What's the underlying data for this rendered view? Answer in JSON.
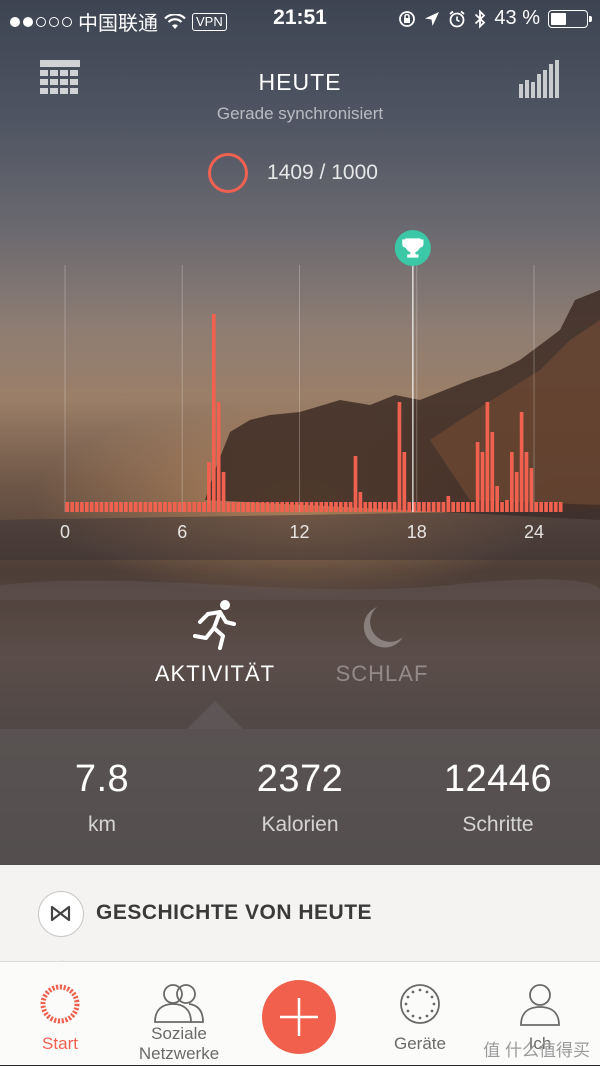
{
  "status_bar": {
    "carrier": "中国联通",
    "vpn": "VPN",
    "time": "21:51",
    "battery": "43 %",
    "battery_level": 0.43,
    "signal_dots_filled": 2,
    "signal_dots_total": 5
  },
  "header": {
    "title": "HEUTE",
    "subtitle": "Gerade synchronisiert",
    "goal_text": "1409 / 1000",
    "calendar_icon": "calendar-icon",
    "history_icon": "bar-chart-icon"
  },
  "chart_data": {
    "type": "bar",
    "x_ticks": [
      "0",
      "6",
      "12",
      "18",
      "24"
    ],
    "goal_marker_hour": 17.8,
    "goal_marker_icon": "trophy-icon",
    "bar_color": "#f16150",
    "bar_minutes_interval": 15,
    "values": [
      0.05,
      0.05,
      0.05,
      0.05,
      0.05,
      0.05,
      0.05,
      0.05,
      0.05,
      0.05,
      0.05,
      0.05,
      0.05,
      0.05,
      0.05,
      0.05,
      0.05,
      0.05,
      0.05,
      0.05,
      0.05,
      0.05,
      0.05,
      0.05,
      0.05,
      0.05,
      0.05,
      0.05,
      0.05,
      0.25,
      0.99,
      0.55,
      0.2,
      0.05,
      0.05,
      0.05,
      0.05,
      0.05,
      0.05,
      0.05,
      0.05,
      0.05,
      0.05,
      0.05,
      0.05,
      0.05,
      0.05,
      0.05,
      0.05,
      0.05,
      0.05,
      0.05,
      0.05,
      0.05,
      0.05,
      0.05,
      0.05,
      0.05,
      0.05,
      0.28,
      0.1,
      0.05,
      0.05,
      0.05,
      0.05,
      0.05,
      0.05,
      0.05,
      0.55,
      0.3,
      0.05,
      0.05,
      0.05,
      0.05,
      0.05,
      0.05,
      0.05,
      0.05,
      0.08,
      0.05,
      0.05,
      0.05,
      0.05,
      0.05,
      0.35,
      0.3,
      0.55,
      0.4,
      0.13,
      0.05,
      0.06,
      0.3,
      0.2,
      0.5,
      0.3,
      0.22,
      0.05,
      0.05,
      0.05,
      0.05,
      0.05,
      0.05
    ]
  },
  "modes": {
    "activity": {
      "label": "AKTIVITÄT",
      "icon": "running-icon"
    },
    "sleep": {
      "label": "SCHLAF",
      "icon": "moon-icon"
    }
  },
  "stats": [
    {
      "value": "7.8",
      "label": "km"
    },
    {
      "value": "2372",
      "label": "Kalorien"
    },
    {
      "value": "12446",
      "label": "Schritte"
    }
  ],
  "story": {
    "title": "GESCHICHTE VON HEUTE",
    "icon": "misfit-logo-icon"
  },
  "tab_bar": {
    "items": [
      {
        "label": "Start",
        "icon": "start-ring-icon"
      },
      {
        "label_line1": "Soziale",
        "label_line2": "Netzwerke",
        "icon": "people-icon"
      },
      {
        "label": "",
        "icon": "plus-icon"
      },
      {
        "label": "Geräte",
        "icon": "device-icon"
      },
      {
        "label": "Ich",
        "icon": "person-icon"
      }
    ],
    "watermark": "值 什么值得买"
  },
  "colors": {
    "accent": "#f16150",
    "goal_marker": "#3cc7a6"
  }
}
